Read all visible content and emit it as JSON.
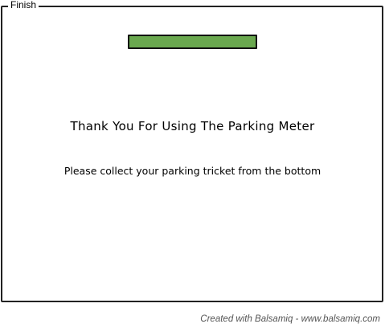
{
  "window": {
    "title": "Finish"
  },
  "progress": {
    "fraction": 1.0,
    "fill_color": "#6aa84f"
  },
  "content": {
    "headline": "Thank You For Using The Parking Meter",
    "message": "Please collect your parking tricket from the bottom"
  },
  "footer": {
    "credit": "Created with Balsamiq - www.balsamiq.com"
  }
}
